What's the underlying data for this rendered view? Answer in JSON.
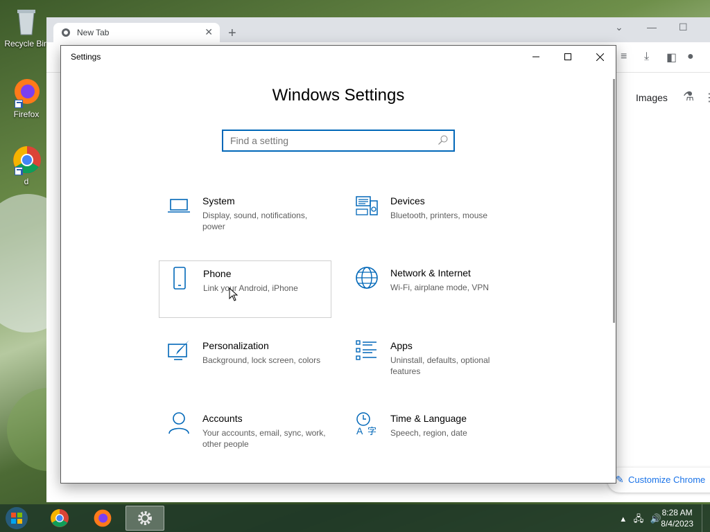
{
  "desktop": {
    "icons": [
      {
        "label": "Recycle Bin",
        "name": "recycle-bin"
      },
      {
        "label": "Firefox",
        "name": "firefox"
      },
      {
        "label": "d",
        "name": "chrome-shortcut"
      }
    ]
  },
  "chrome": {
    "tab_title": "New Tab",
    "images_link": "Images",
    "customize_label": "Customize Chrome"
  },
  "settings": {
    "window_title": "Settings",
    "heading": "Windows Settings",
    "search_placeholder": "Find a setting",
    "tiles": [
      {
        "name": "System",
        "desc": "Display, sound, notifications, power",
        "icon": "laptop-icon"
      },
      {
        "name": "Devices",
        "desc": "Bluetooth, printers, mouse",
        "icon": "devices-icon"
      },
      {
        "name": "Phone",
        "desc": "Link your Android, iPhone",
        "icon": "phone-icon"
      },
      {
        "name": "Network & Internet",
        "desc": "Wi-Fi, airplane mode, VPN",
        "icon": "globe-icon"
      },
      {
        "name": "Personalization",
        "desc": "Background, lock screen, colors",
        "icon": "personalization-icon"
      },
      {
        "name": "Apps",
        "desc": "Uninstall, defaults, optional features",
        "icon": "apps-list-icon"
      },
      {
        "name": "Accounts",
        "desc": "Your accounts, email, sync, work, other people",
        "icon": "person-icon"
      },
      {
        "name": "Time & Language",
        "desc": "Speech, region, date",
        "icon": "time-language-icon"
      }
    ],
    "accent_color": "#0067b8"
  },
  "taskbar": {
    "time": "8:28 AM",
    "date": "8/4/2023"
  }
}
